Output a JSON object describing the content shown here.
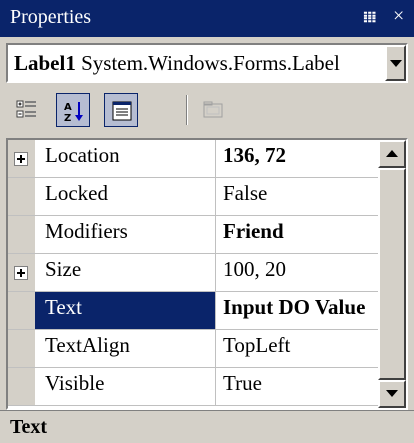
{
  "window": {
    "title": "Properties",
    "pin_glyph": "p",
    "close_glyph": "×"
  },
  "object_selector": {
    "name": "Label1",
    "type": "System.Windows.Forms.Label"
  },
  "toolbar": {
    "buttons": [
      {
        "icon": "categorized-icon",
        "pressed": false
      },
      {
        "icon": "alphabetical-sort-icon",
        "pressed": true
      },
      {
        "icon": "properties-icon",
        "pressed": true
      },
      {
        "icon": "property-pages-icon",
        "pressed": false,
        "disabled": true
      }
    ],
    "alpha_top": "A",
    "alpha_bottom": "Z"
  },
  "properties": [
    {
      "name": "Location",
      "value": "136, 72",
      "bold": true,
      "expandable": true
    },
    {
      "name": "Locked",
      "value": "False",
      "bold": false,
      "expandable": false
    },
    {
      "name": "Modifiers",
      "value": "Friend",
      "bold": true,
      "expandable": false
    },
    {
      "name": "Size",
      "value": "100, 20",
      "bold": false,
      "expandable": true
    },
    {
      "name": "Text",
      "value": "Input DO Value",
      "bold": true,
      "expandable": false,
      "selected": true
    },
    {
      "name": "TextAlign",
      "value": "TopLeft",
      "bold": false,
      "expandable": false
    },
    {
      "name": "Visible",
      "value": "True",
      "bold": false,
      "expandable": false
    }
  ],
  "description": {
    "title": "Text"
  },
  "colors": {
    "titlebar": "#0a246a",
    "selection": "#0a246a",
    "face": "#d4d0c8"
  }
}
